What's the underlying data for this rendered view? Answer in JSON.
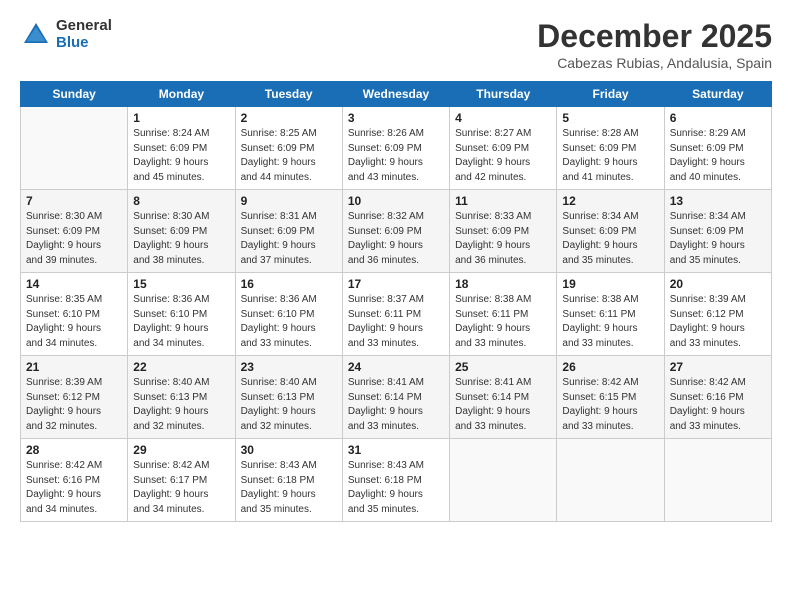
{
  "logo": {
    "general": "General",
    "blue": "Blue"
  },
  "title": "December 2025",
  "subtitle": "Cabezas Rubias, Andalusia, Spain",
  "header_days": [
    "Sunday",
    "Monday",
    "Tuesday",
    "Wednesday",
    "Thursday",
    "Friday",
    "Saturday"
  ],
  "weeks": [
    [
      {
        "day": "",
        "info": ""
      },
      {
        "day": "1",
        "info": "Sunrise: 8:24 AM\nSunset: 6:09 PM\nDaylight: 9 hours\nand 45 minutes."
      },
      {
        "day": "2",
        "info": "Sunrise: 8:25 AM\nSunset: 6:09 PM\nDaylight: 9 hours\nand 44 minutes."
      },
      {
        "day": "3",
        "info": "Sunrise: 8:26 AM\nSunset: 6:09 PM\nDaylight: 9 hours\nand 43 minutes."
      },
      {
        "day": "4",
        "info": "Sunrise: 8:27 AM\nSunset: 6:09 PM\nDaylight: 9 hours\nand 42 minutes."
      },
      {
        "day": "5",
        "info": "Sunrise: 8:28 AM\nSunset: 6:09 PM\nDaylight: 9 hours\nand 41 minutes."
      },
      {
        "day": "6",
        "info": "Sunrise: 8:29 AM\nSunset: 6:09 PM\nDaylight: 9 hours\nand 40 minutes."
      }
    ],
    [
      {
        "day": "7",
        "info": "Sunrise: 8:30 AM\nSunset: 6:09 PM\nDaylight: 9 hours\nand 39 minutes."
      },
      {
        "day": "8",
        "info": "Sunrise: 8:30 AM\nSunset: 6:09 PM\nDaylight: 9 hours\nand 38 minutes."
      },
      {
        "day": "9",
        "info": "Sunrise: 8:31 AM\nSunset: 6:09 PM\nDaylight: 9 hours\nand 37 minutes."
      },
      {
        "day": "10",
        "info": "Sunrise: 8:32 AM\nSunset: 6:09 PM\nDaylight: 9 hours\nand 36 minutes."
      },
      {
        "day": "11",
        "info": "Sunrise: 8:33 AM\nSunset: 6:09 PM\nDaylight: 9 hours\nand 36 minutes."
      },
      {
        "day": "12",
        "info": "Sunrise: 8:34 AM\nSunset: 6:09 PM\nDaylight: 9 hours\nand 35 minutes."
      },
      {
        "day": "13",
        "info": "Sunrise: 8:34 AM\nSunset: 6:09 PM\nDaylight: 9 hours\nand 35 minutes."
      }
    ],
    [
      {
        "day": "14",
        "info": "Sunrise: 8:35 AM\nSunset: 6:10 PM\nDaylight: 9 hours\nand 34 minutes."
      },
      {
        "day": "15",
        "info": "Sunrise: 8:36 AM\nSunset: 6:10 PM\nDaylight: 9 hours\nand 34 minutes."
      },
      {
        "day": "16",
        "info": "Sunrise: 8:36 AM\nSunset: 6:10 PM\nDaylight: 9 hours\nand 33 minutes."
      },
      {
        "day": "17",
        "info": "Sunrise: 8:37 AM\nSunset: 6:11 PM\nDaylight: 9 hours\nand 33 minutes."
      },
      {
        "day": "18",
        "info": "Sunrise: 8:38 AM\nSunset: 6:11 PM\nDaylight: 9 hours\nand 33 minutes."
      },
      {
        "day": "19",
        "info": "Sunrise: 8:38 AM\nSunset: 6:11 PM\nDaylight: 9 hours\nand 33 minutes."
      },
      {
        "day": "20",
        "info": "Sunrise: 8:39 AM\nSunset: 6:12 PM\nDaylight: 9 hours\nand 33 minutes."
      }
    ],
    [
      {
        "day": "21",
        "info": "Sunrise: 8:39 AM\nSunset: 6:12 PM\nDaylight: 9 hours\nand 32 minutes."
      },
      {
        "day": "22",
        "info": "Sunrise: 8:40 AM\nSunset: 6:13 PM\nDaylight: 9 hours\nand 32 minutes."
      },
      {
        "day": "23",
        "info": "Sunrise: 8:40 AM\nSunset: 6:13 PM\nDaylight: 9 hours\nand 32 minutes."
      },
      {
        "day": "24",
        "info": "Sunrise: 8:41 AM\nSunset: 6:14 PM\nDaylight: 9 hours\nand 33 minutes."
      },
      {
        "day": "25",
        "info": "Sunrise: 8:41 AM\nSunset: 6:14 PM\nDaylight: 9 hours\nand 33 minutes."
      },
      {
        "day": "26",
        "info": "Sunrise: 8:42 AM\nSunset: 6:15 PM\nDaylight: 9 hours\nand 33 minutes."
      },
      {
        "day": "27",
        "info": "Sunrise: 8:42 AM\nSunset: 6:16 PM\nDaylight: 9 hours\nand 33 minutes."
      }
    ],
    [
      {
        "day": "28",
        "info": "Sunrise: 8:42 AM\nSunset: 6:16 PM\nDaylight: 9 hours\nand 34 minutes."
      },
      {
        "day": "29",
        "info": "Sunrise: 8:42 AM\nSunset: 6:17 PM\nDaylight: 9 hours\nand 34 minutes."
      },
      {
        "day": "30",
        "info": "Sunrise: 8:43 AM\nSunset: 6:18 PM\nDaylight: 9 hours\nand 35 minutes."
      },
      {
        "day": "31",
        "info": "Sunrise: 8:43 AM\nSunset: 6:18 PM\nDaylight: 9 hours\nand 35 minutes."
      },
      {
        "day": "",
        "info": ""
      },
      {
        "day": "",
        "info": ""
      },
      {
        "day": "",
        "info": ""
      }
    ]
  ]
}
